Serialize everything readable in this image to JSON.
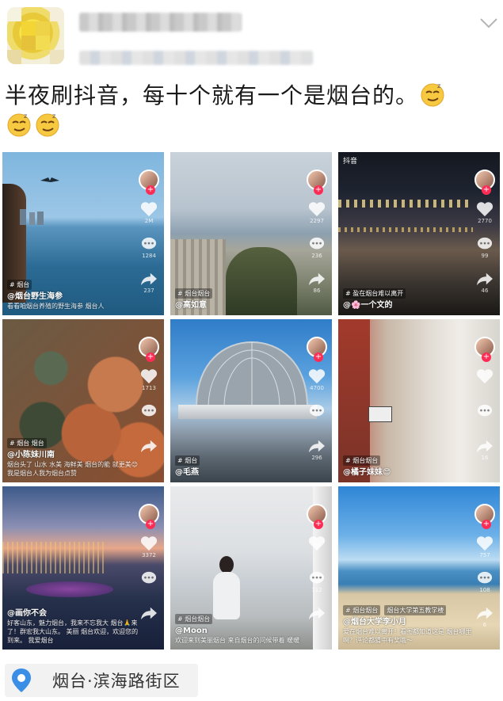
{
  "post": {
    "text": "半夜刷抖音，每十个就有一个是烟台的。",
    "emoji_count": 3,
    "emoji_name": "smirk-emoji"
  },
  "location": {
    "text": "烟台·滨海路街区",
    "icon": "location-pin-icon"
  },
  "tiles": [
    {
      "tag": "# 烟台",
      "user": "@烟台野生海参",
      "desc": "看看咱烟台养殖的野生海参  烟台人",
      "counts": [
        "2M",
        "1284",
        "237"
      ],
      "scene": "sea"
    },
    {
      "tag": "# 烟台烟台",
      "user": "@高如意",
      "desc": "",
      "counts": [
        "2297",
        "236",
        "86"
      ],
      "scene": "city"
    },
    {
      "tag": "# 盈在烟台难以离开",
      "user": "@🌸一个文的",
      "desc": "",
      "counts": [
        "2770",
        "99",
        "46"
      ],
      "scene": "night",
      "logo": "抖音"
    },
    {
      "tag": "# 烟台 烟台",
      "user": "@小陈妹川南",
      "desc": "烟台头了 山水 水美 海鲜美 烟台的能 就更美😊我是烟台人我为烟台点赞",
      "counts": [
        "1713",
        "",
        ""
      ],
      "scene": "seafood"
    },
    {
      "tag": "# 烟台",
      "user": "@毛燕",
      "desc": "",
      "counts": [
        "4700",
        "",
        "296"
      ],
      "scene": "dome"
    },
    {
      "tag": "# 烟台烟台",
      "user": "@橘子妹妹😊",
      "desc": "",
      "counts": [
        "",
        "",
        "16"
      ],
      "scene": "street"
    },
    {
      "tag": "",
      "user": "@画你不会",
      "desc": "好客山东，魅力烟台，我来不忘我大 烟台🙏来了！群宏我大山东。 美丽 烟台欢迎，欢迎您的到来。 我爱烟台",
      "counts": [
        "3372",
        "",
        ""
      ],
      "scene": "dusk"
    },
    {
      "tag": "# 烟台烟台",
      "user": "@Moon",
      "desc": "欢迎来到美丽烟台 来自烟台的问候带着 暖暖",
      "counts": [
        "",
        "112",
        ""
      ],
      "scene": "beachgirl"
    },
    {
      "tag": "# 烟台烟台",
      "user": "@烟台大学李小月",
      "desc": "爱在烟台难以离开！看图都知道这是 烟台哪里啊？评论都猜中有奖哦～",
      "counts": [
        "757",
        "108",
        "6"
      ],
      "scene": "beach",
      "music": "烟台大学第五教学楼"
    }
  ],
  "colors": {
    "like_heart": "#ffffff",
    "follow_plus": "#fe2c55",
    "location_bg": "#f2f2f2",
    "pin": "#3a8ee6"
  }
}
